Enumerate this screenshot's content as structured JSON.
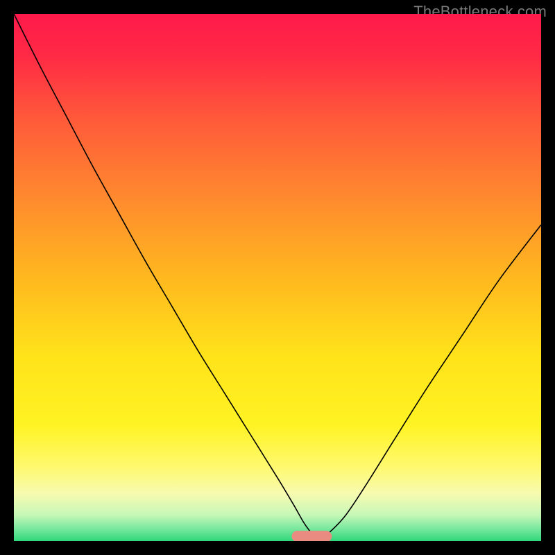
{
  "watermark": "TheBottleneck.com",
  "colors": {
    "frame": "#000000",
    "curve": "#000000",
    "marker_fill": "#e98b80",
    "marker_stroke": "#e98b80",
    "gradient_stops": [
      {
        "offset": 0.0,
        "color": "#ff1a4b"
      },
      {
        "offset": 0.08,
        "color": "#ff2a45"
      },
      {
        "offset": 0.2,
        "color": "#ff5a3a"
      },
      {
        "offset": 0.35,
        "color": "#ff8a2e"
      },
      {
        "offset": 0.5,
        "color": "#ffb81f"
      },
      {
        "offset": 0.65,
        "color": "#ffe31a"
      },
      {
        "offset": 0.78,
        "color": "#fff324"
      },
      {
        "offset": 0.86,
        "color": "#fff970"
      },
      {
        "offset": 0.91,
        "color": "#f7fbb0"
      },
      {
        "offset": 0.95,
        "color": "#c7f7b7"
      },
      {
        "offset": 0.975,
        "color": "#7de9a0"
      },
      {
        "offset": 1.0,
        "color": "#2fd77a"
      }
    ]
  },
  "chart_data": {
    "type": "line",
    "title": "",
    "xlabel": "",
    "ylabel": "",
    "xlim": [
      0,
      100
    ],
    "ylim": [
      0,
      100
    ],
    "x": [
      0,
      5,
      10,
      15,
      20,
      25,
      30,
      35,
      40,
      45,
      50,
      53,
      55,
      56.5,
      58,
      60,
      63,
      67,
      72,
      78,
      85,
      92,
      100
    ],
    "values": [
      100,
      90,
      80.5,
      71,
      62,
      53,
      44.5,
      36,
      28,
      20,
      12,
      7,
      3.5,
      1.5,
      0.4,
      1.8,
      5,
      11,
      19,
      28.5,
      39,
      49.5,
      60
    ],
    "marker": {
      "shape": "rounded-bar",
      "x_center": 56.5,
      "y_center": 0.9,
      "width": 7.5,
      "height": 2.0,
      "rx": 1.0
    }
  }
}
